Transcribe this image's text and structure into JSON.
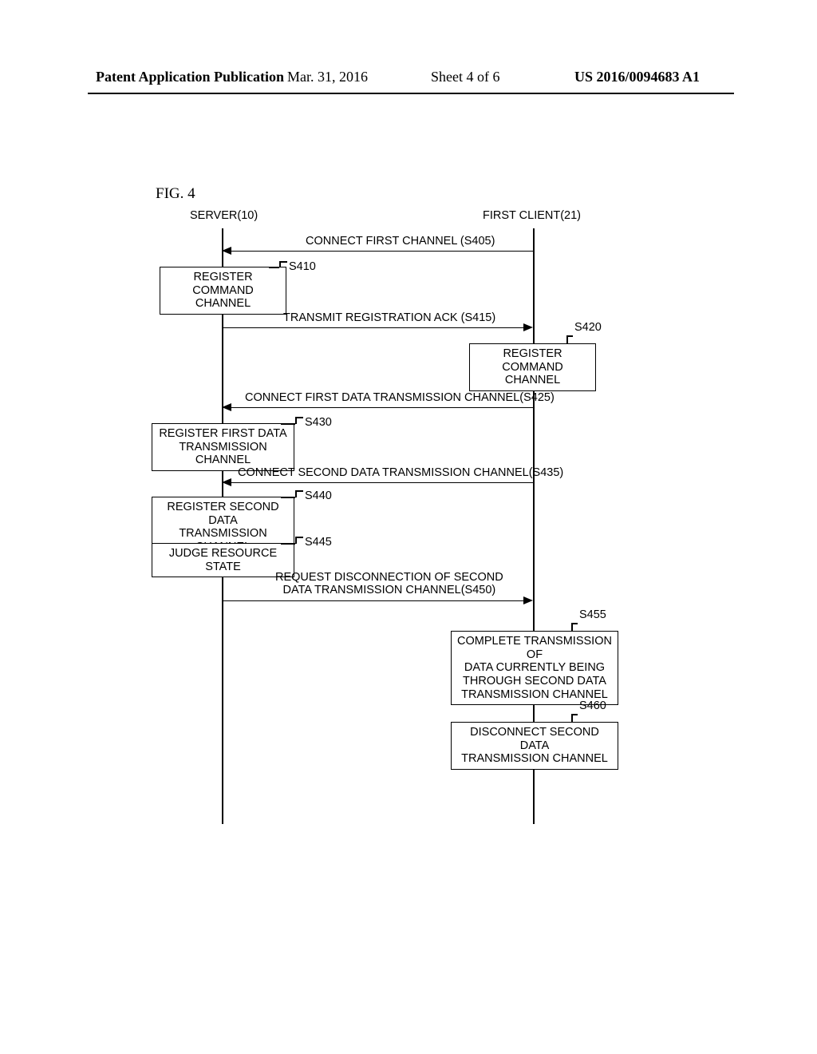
{
  "header": {
    "left": "Patent Application Publication",
    "date": "Mar. 31, 2016",
    "sheet": "Sheet 4 of 6",
    "pubnum": "US 2016/0094683 A1"
  },
  "figure": {
    "label": "FIG. 4"
  },
  "participants": {
    "server": "SERVER(10)",
    "client": "FIRST CLIENT(21)"
  },
  "steps": {
    "s405": "CONNECT FIRST CHANNEL (S405)",
    "s410_box": "REGISTER COMMAND\nCHANNEL",
    "s410_label": "S410",
    "s415": "TRANSMIT REGISTRATION ACK (S415)",
    "s420_box": "REGISTER COMMAND\nCHANNEL",
    "s420_label": "S420",
    "s425": "CONNECT FIRST DATA TRANSMISSION CHANNEL(S425)",
    "s430_box": "REGISTER FIRST DATA\nTRANSMISSION CHANNEL",
    "s430_label": "S430",
    "s435": "CONNECT SECOND DATA TRANSMISSION CHANNEL(S435)",
    "s440_box": "REGISTER SECOND DATA\nTRANSMISSION CHANNEL",
    "s440_label": "S440",
    "s445_box": "JUDGE RESOURCE STATE",
    "s445_label": "S445",
    "s450": "REQUEST DISCONNECTION OF SECOND\nDATA TRANSMISSION CHANNEL(S450)",
    "s455_box": "COMPLETE TRANSMISSION OF\nDATA CURRENTLY BEING\nTHROUGH SECOND DATA\nTRANSMISSION CHANNEL",
    "s455_label": "S455",
    "s460_box": "DISCONNECT SECOND DATA\nTRANSMISSION CHANNEL",
    "s460_label": "S460"
  }
}
